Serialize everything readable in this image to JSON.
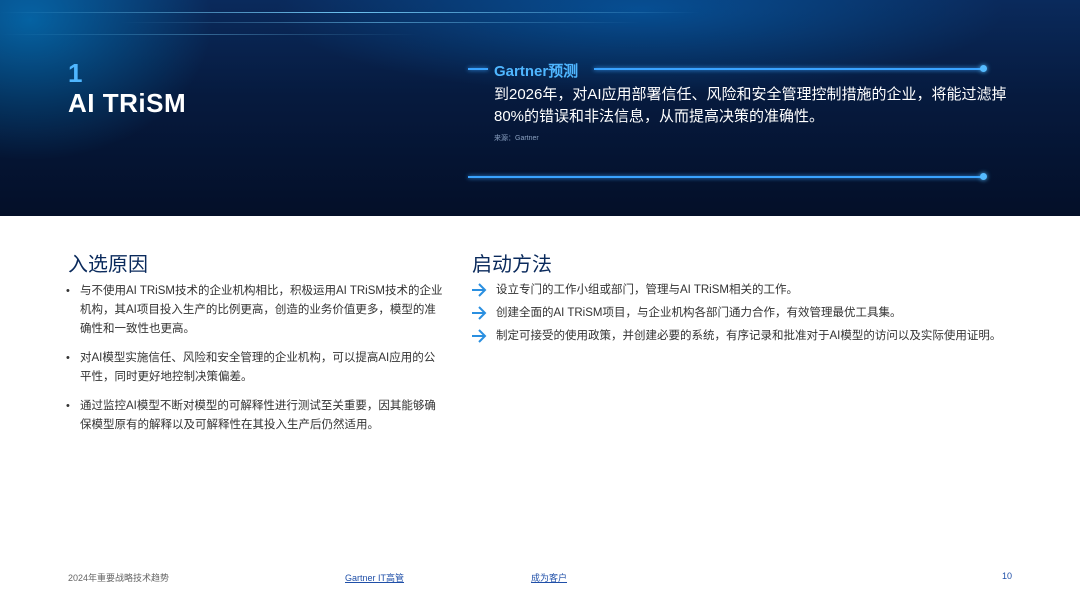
{
  "hero": {
    "number": "1",
    "title": "AI TRiSM"
  },
  "quote": {
    "label": "Gartner预测",
    "text": "到2026年，对AI应用部署信任、风险和安全管理控制措施的企业，将能过滤掉80%的错误和非法信息，从而提高决策的准确性。",
    "source": "来源：Gartner"
  },
  "reasons": {
    "title": "入选原因",
    "items": [
      "与不使用AI TRiSM技术的企业机构相比，积极运用AI TRiSM技术的企业机构，其AI项目投入生产的比例更高，创造的业务价值更多，模型的准确性和一致性也更高。",
      "对AI模型实施信任、风险和安全管理的企业机构，可以提高AI应用的公平性，同时更好地控制决策偏差。",
      "通过监控AI模型不断对模型的可解释性进行测试至关重要，因其能够确保模型原有的解释以及可解释性在其投入生产后仍然适用。"
    ]
  },
  "steps": {
    "title": "启动方法",
    "items": [
      "设立专门的工作小组或部门，管理与AI TRiSM相关的工作。",
      "创建全面的AI TRiSM项目，与企业机构各部门通力合作，有效管理最优工具集。",
      "制定可接受的使用政策，并创建必要的系统，有序记录和批准对于AI模型的访问以及实际使用证明。"
    ]
  },
  "footer": {
    "doc_title": "2024年重要战略技术趋势",
    "link_gartner": "Gartner IT高管",
    "link_client": "成为客户",
    "page_number": "10"
  },
  "colors": {
    "accent": "#4fb6ff",
    "heading": "#0a2a5c",
    "arrow": "#2a8fe0"
  }
}
